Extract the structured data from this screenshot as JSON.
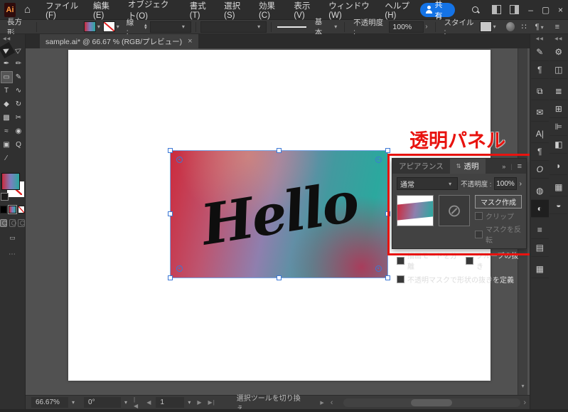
{
  "icons": {
    "ai-logo": "Ai",
    "home-icon": "⌂",
    "minimize-icon": "–",
    "maximize-icon": "▢",
    "close-icon": "×",
    "chevron-down-icon": "▾",
    "chevron-right-icon": "›",
    "double-chevron-icon": "»",
    "panel-menu-icon": "≡",
    "stepper-up": "▲",
    "stepper-down": "▼",
    "selection-tool-icon": "▶",
    "direct-selection-tool-icon": "▷",
    "pen-tool-icon": "✒",
    "paintbrush-tool-icon": "✏",
    "rectangle-tool-icon": "▭",
    "pencil-tool-icon": "✎",
    "type-tool-icon": "T",
    "curvature-tool-icon": "∿",
    "shaper-tool-icon": "◆",
    "rotate-tool-icon": "↻",
    "gradient-tool-icon": "▩",
    "scissors-tool-icon": "✂",
    "hand-tool-icon": "≈",
    "symbol-tool-icon": "◉",
    "artboard-tool-icon": "▣",
    "zoom-tool-icon": "Q",
    "knife-tool-icon": "∕",
    "screen-mode-icon": "▭",
    "more-tools-icon": "⋯",
    "glyph-options-icon": "✎",
    "paragraph-options-icon": "¶",
    "css-export-icon": "⧉",
    "comments-icon": "✉",
    "character-panel-icon": "A|",
    "paragraph-panel-icon": "¶",
    "opentype-panel-icon": "O",
    "color-panel-icon": "◍",
    "transparency-panel-icon": "◐",
    "stroke-panel-icon": "≡",
    "gradient-panel-icon": "▤",
    "swatches-panel-icon": "▦",
    "properties-panel-icon": "⚙",
    "libraries-panel-icon": "◫",
    "layers-panel-icon": "≣",
    "artboards-panel-icon": "⊞",
    "align-panel-icon": "⊫",
    "pathfinder-panel-icon": "◧",
    "appearance-panel-icon": "◗",
    "graphic-styles-panel-icon": "▦",
    "color-guide-panel-icon": "◒",
    "collapse-dock-icon": "◀◀",
    "workspace-icon": "∷",
    "control-paragraph-icon": "¶",
    "control-menu-icon": "≡",
    "nav-first-icon": "|◀",
    "nav-prev-icon": "◀",
    "nav-next-icon": "▶",
    "nav-last-icon": "▶|",
    "no-mask-icon": "⊘",
    "panel-cycle-icon": "⇅",
    "scroll-left-icon": "‹",
    "scroll-right-icon": "›",
    "scroll-down-icon": "▾",
    "play-icon": "▶"
  },
  "colors": {
    "annotation_red": "#e8130f",
    "selection_blue": "#3b78d6",
    "share_blue": "#1473e6"
  },
  "titlebar": {
    "menus": [
      "ファイル(F)",
      "編集(E)",
      "オブジェクト(O)",
      "書式(T)",
      "選択(S)",
      "効果(C)",
      "表示(V)",
      "ウィンドウ(W)",
      "ヘルプ(H)"
    ],
    "share": "共有"
  },
  "controlbar": {
    "shape": "長方形",
    "stroke_label": "線 :",
    "brush_style": "基本",
    "opacity_label": "不透明度 :",
    "opacity_value": "100%",
    "style_label": "スタイル :"
  },
  "tabbar": {
    "doc_title": "sample.ai* @ 66.67 % (RGB/プレビュー)",
    "close": "×"
  },
  "canvas": {
    "hello": "Hello"
  },
  "annotation": {
    "label": "透明パネル"
  },
  "panel": {
    "tab_appearance": "アピアランス",
    "tab_transparency": "透明",
    "blend_mode": "通常",
    "opacity_label": "不透明度 :",
    "opacity_value": "100%",
    "make_mask": "マスク作成",
    "clip": "クリップ",
    "invert_mask": "マスクを反転",
    "isolate_blending": "描画モードを分離",
    "knockout_group": "グループの抜き",
    "opacity_mask_shape": "不透明マスクで形状の抜きを定義"
  },
  "statusbar": {
    "zoom": "66.67%",
    "rotation": "0°",
    "page": "1",
    "hint": "選択ツールを切り換え"
  }
}
